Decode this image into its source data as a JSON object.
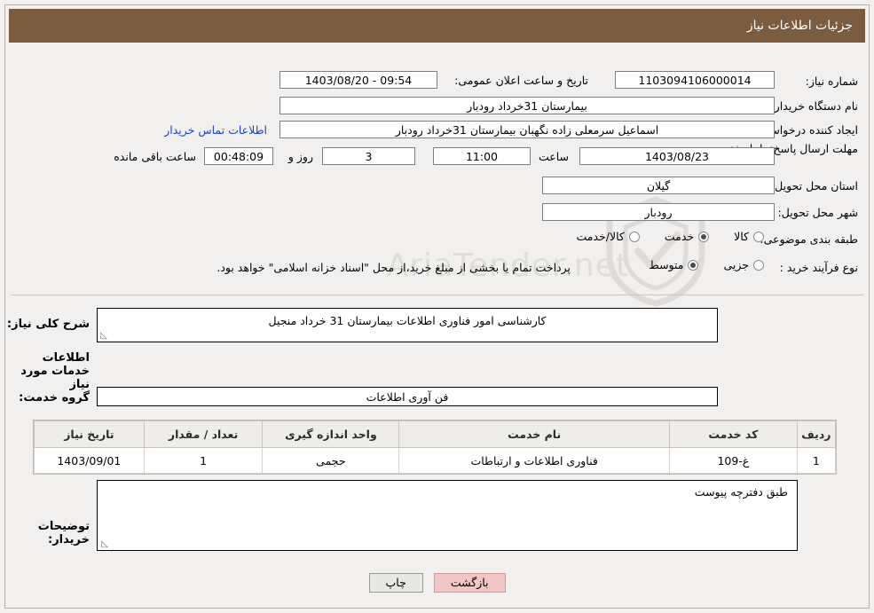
{
  "header": {
    "title": "جزئیات اطلاعات نیاز"
  },
  "watermark": {
    "text": "AriaTender.net"
  },
  "details": {
    "need_number_label": "شماره نیاز:",
    "need_number_value": "1103094106000014",
    "announce_datetime_label": "تاریخ و ساعت اعلان عمومی:",
    "announce_datetime_value": "1403/08/20 - 09:54",
    "buyer_org_label": "نام دستگاه خریدار:",
    "buyer_org_value": "بیمارستان 31خرداد رودبار",
    "requester_label": "ایجاد کننده درخواست:",
    "requester_value": "اسماعیل سرمعلی زاده نگهبان بیمارستان 31خرداد رودبار",
    "contact_link": "اطلاعات تماس خریدار",
    "deadline_label": "مهلت ارسال پاسخ: تا تاریخ:",
    "deadline_date": "1403/08/23",
    "hour_label": "ساعت",
    "deadline_hour": "11:00",
    "days_value": "3",
    "days_label": "روز و",
    "remaining_time": "00:48:09",
    "remaining_label": "ساعت باقی مانده",
    "province_label": "استان محل تحویل:",
    "province_value": "گیلان",
    "city_label": "شهر محل تحویل:",
    "city_value": "رودبار",
    "category_label": "طبقه بندی موضوعی:",
    "category_options": [
      {
        "label": "کالا",
        "checked": false
      },
      {
        "label": "خدمت",
        "checked": true
      },
      {
        "label": "کالا/خدمت",
        "checked": false
      }
    ],
    "purchase_type_label": "نوع فرآیند خرید :",
    "purchase_type_options": [
      {
        "label": "جزیی",
        "checked": false
      },
      {
        "label": "متوسط",
        "checked": true
      }
    ],
    "purchase_note": "پرداخت تمام یا بخشی از مبلغ خرید،از محل \"اسناد خزانه اسلامی\" خواهد بود."
  },
  "middle": {
    "general_desc_label": "شرح کلی نیاز:",
    "general_desc_value": "کارشناسی امور فناوری اطلاعات بیمارستان 31 خرداد منجیل",
    "services_info_title": "اطلاعات خدمات مورد نیاز",
    "service_group_label": "گروه خدمت:",
    "service_group_value": "فن آوری اطلاعات"
  },
  "table": {
    "headers": [
      "ردیف",
      "کد خدمت",
      "نام خدمت",
      "واحد اندازه گیری",
      "تعداد / مقدار",
      "تاریخ نیاز"
    ],
    "rows": [
      {
        "row": "1",
        "code": "غ-109",
        "name": "فناوری اطلاعات و ارتباطات",
        "unit": "حجمی",
        "qty": "1",
        "date": "1403/09/01"
      }
    ]
  },
  "buyer_desc": {
    "label": "توضیحات خریدار:",
    "value": "طبق دفترچه پیوست"
  },
  "footer": {
    "print_label": "چاپ",
    "back_label": "بازگشت"
  }
}
